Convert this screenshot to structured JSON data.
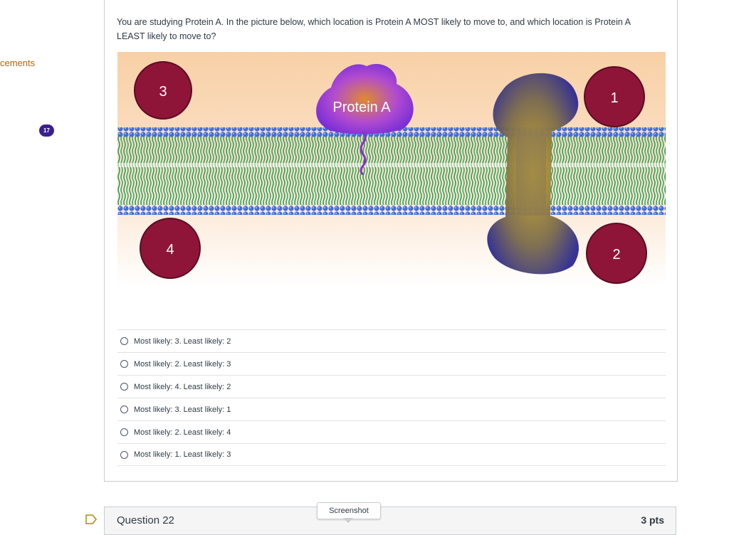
{
  "sidebar": {
    "partial_link": "cements",
    "badge_count": "17"
  },
  "question": {
    "text": "You are studying Protein A. In the picture below, which location is Protein A MOST likely to move to, and which location is Protein A LEAST likely to move to?",
    "figure": {
      "protein_label": "Protein A",
      "markers": [
        "3",
        "1",
        "4",
        "2"
      ]
    },
    "answers": [
      {
        "label": "Most likely: 3. Least likely: 2",
        "selected": false
      },
      {
        "label": "Most likely: 2. Least likely: 3",
        "selected": false
      },
      {
        "label": "Most likely: 4. Least likely: 2",
        "selected": false
      },
      {
        "label": "Most likely: 3. Least likely: 1",
        "selected": false
      },
      {
        "label": "Most likely: 2. Least likely: 4",
        "selected": false
      },
      {
        "label": "Most likely: 1. Least likely: 3",
        "selected": false
      }
    ]
  },
  "next_question": {
    "title": "Question 22",
    "points": "3 pts"
  },
  "tooltip": {
    "text": "Screenshot"
  },
  "colors": {
    "marker_fill": "#8f1538",
    "protein_fill": "#7b2fd6",
    "lipid_head": "#3d6fd8",
    "lipid_tail": "#2e9a58",
    "badge": "#3b1f8f",
    "link": "#b3650c"
  }
}
